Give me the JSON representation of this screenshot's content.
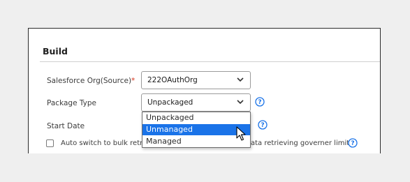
{
  "section": {
    "title": "Build"
  },
  "fields": {
    "org": {
      "label": "Salesforce Org(Source)",
      "required_mark": "*",
      "value": "222OAuthOrg"
    },
    "package_type": {
      "label": "Package Type",
      "value": "Unpackaged"
    },
    "start_date": {
      "label": "Start Date"
    }
  },
  "checkbox": {
    "label_left": "Auto switch to bulk retri",
    "label_right": "ata retrieving governer limit",
    "checked": false
  },
  "dropdown": {
    "options": [
      "Unpackaged",
      "Unmanaged",
      "Managed"
    ],
    "highlighted": "Unmanaged"
  },
  "colors": {
    "accent": "#1a73e8",
    "required": "#d5321a",
    "help_icon": "#1a73e8"
  },
  "icons": {
    "select_chevron": "chevron-down-icon",
    "help": "question-circle-icon",
    "pointer": "mouse-cursor-icon"
  }
}
